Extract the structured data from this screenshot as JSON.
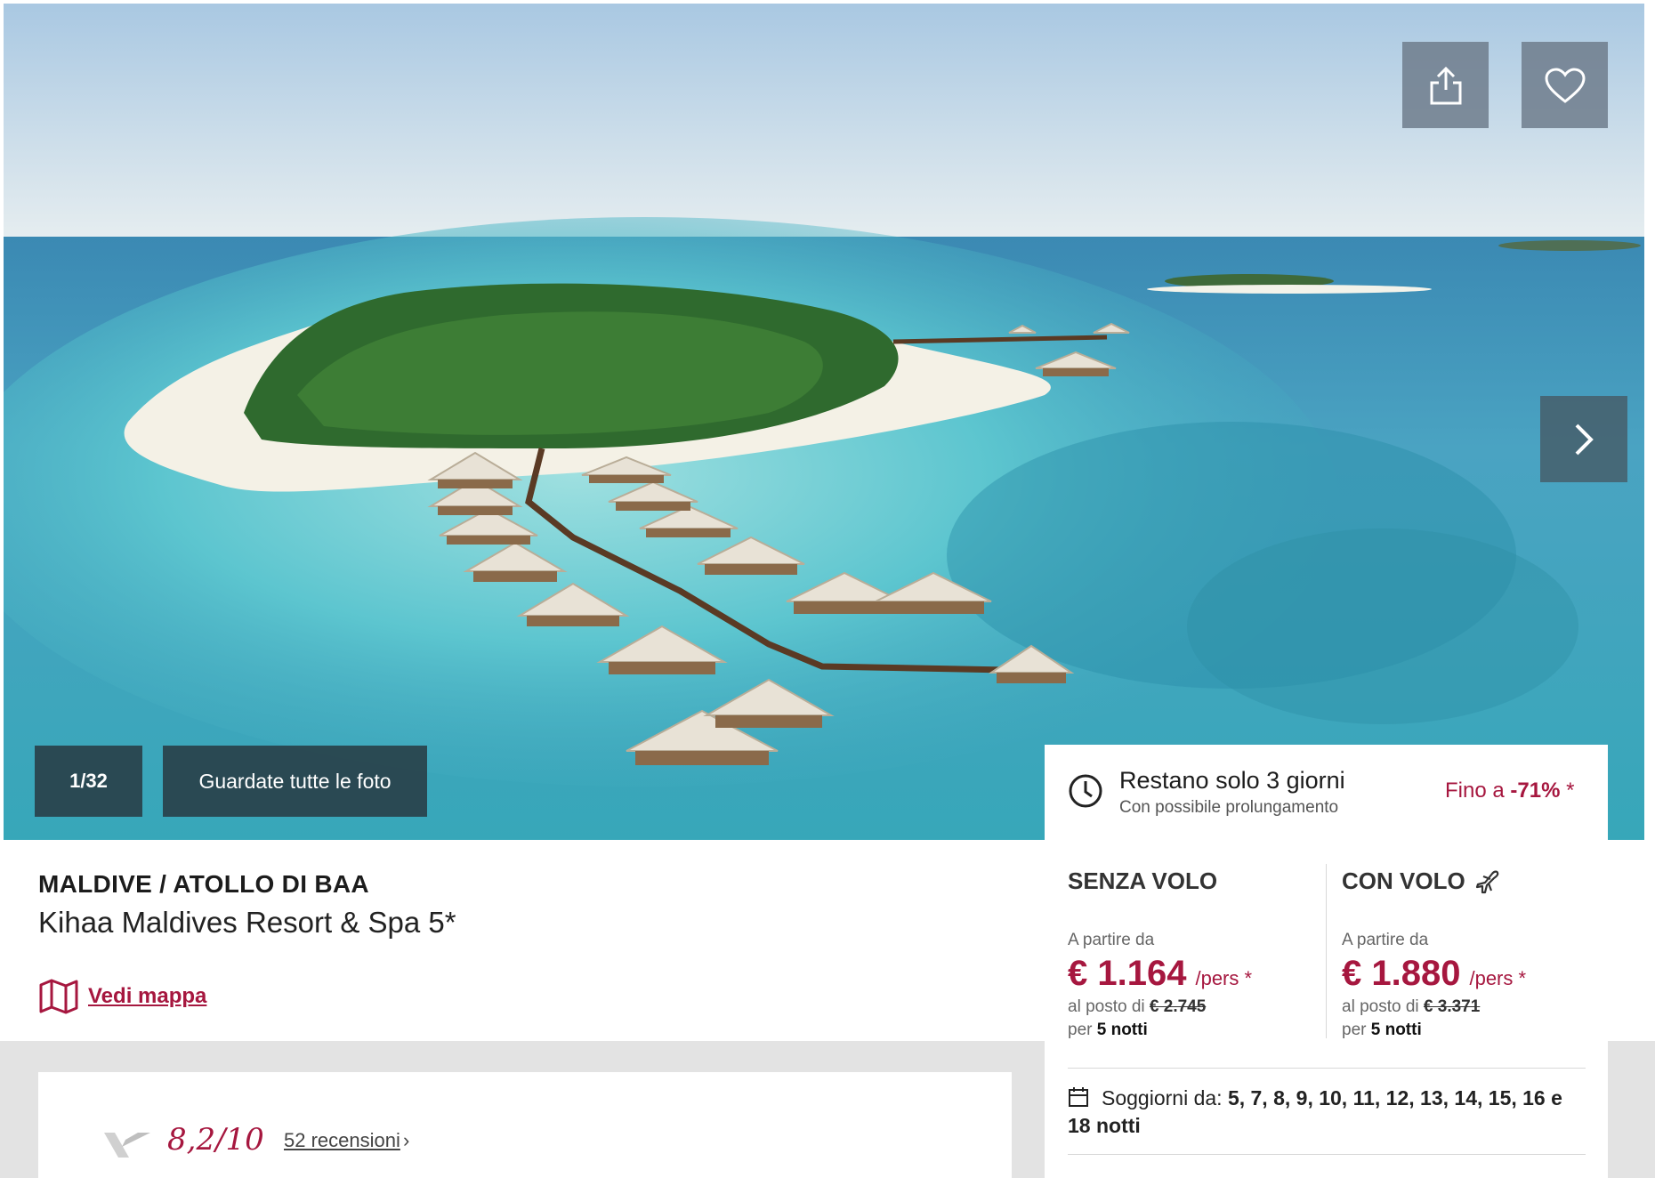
{
  "gallery": {
    "counter": "1/32",
    "all_photos_label": "Guardate tutte le foto"
  },
  "hotel": {
    "region": "MALDIVE / ATOLLO DI BAA",
    "name": "Kihaa Maldives Resort & Spa 5*",
    "map_label": "Vedi mappa"
  },
  "review": {
    "score": "8,2/10",
    "count_label": "52 recensioni"
  },
  "offer": {
    "timer_title": "Restano solo 3 giorni",
    "timer_sub": "Con possibile prolungamento",
    "discount_prefix": "Fino a",
    "discount_value": "-71%",
    "discount_suffix": "*"
  },
  "prices": [
    {
      "heading": "SENZA VOLO",
      "from_label": "A partire da",
      "price": "€ 1.164",
      "per_label": "/pers *",
      "instead_label": "al posto di",
      "old_price": "€ 2.745",
      "for_label": "per",
      "nights": "5 notti"
    },
    {
      "heading": "CON VOLO",
      "from_label": "A partire da",
      "price": "€ 1.880",
      "per_label": "/pers *",
      "instead_label": "al posto di",
      "old_price": "€ 3.371",
      "for_label": "per",
      "nights": "5 notti"
    }
  ],
  "stays": {
    "label": "Soggiorni da:",
    "values": "5, 7, 8, 9, 10, 11, 12, 13, 14, 15, 16 e 18 notti"
  },
  "icons": {
    "share": "share-icon",
    "favorite": "heart-icon",
    "next": "chevron-right-icon",
    "map": "map-icon",
    "clock": "clock-icon",
    "plane": "plane-icon",
    "calendar": "calendar-icon"
  },
  "colors": {
    "accent": "#a6173f",
    "overlay": "#283c44",
    "band": "#e3e3e3"
  }
}
